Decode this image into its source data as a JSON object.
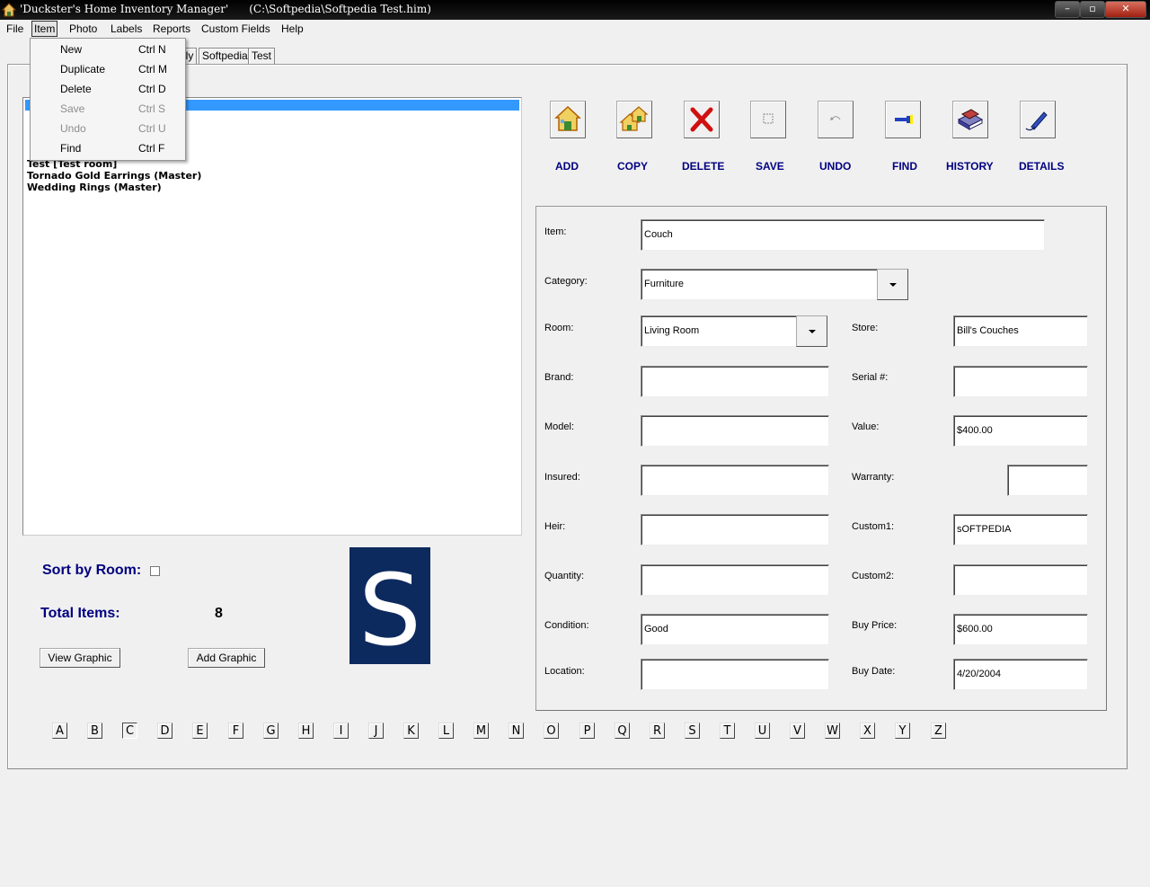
{
  "window": {
    "title": "'Duckster's Home Inventory Manager'      (C:\\Softpedia\\Softpedia Test.him)",
    "minimize": "–",
    "maximize": "▫",
    "close": "✕"
  },
  "menu": [
    "File",
    "Item",
    "Photo",
    "Labels",
    "Reports",
    "Custom Fields",
    "Help"
  ],
  "item_menu": [
    {
      "label": "New",
      "shortcut": "Ctrl N",
      "enabled": true
    },
    {
      "label": "Duplicate",
      "shortcut": "Ctrl M",
      "enabled": true
    },
    {
      "label": "Delete",
      "shortcut": "Ctrl D",
      "enabled": true
    },
    {
      "label": "Save",
      "shortcut": "Ctrl S",
      "enabled": false
    },
    {
      "label": "Undo",
      "shortcut": "Ctrl U",
      "enabled": false
    },
    {
      "label": "Find",
      "shortcut": "Ctrl F",
      "enabled": true
    }
  ],
  "tabs": [
    "lly",
    "Softpedia",
    "Test"
  ],
  "item_list": [
    "Test [Test room]",
    "Tornado Gold Earrings (Master)",
    "Wedding Rings (Master)"
  ],
  "toolbar": [
    {
      "label": "ADD",
      "icon": "house-add-icon"
    },
    {
      "label": "COPY",
      "icon": "house-copy-icon"
    },
    {
      "label": "DELETE",
      "icon": "red-x-icon"
    },
    {
      "label": "SAVE",
      "icon": "save-icon"
    },
    {
      "label": "UNDO",
      "icon": "undo-icon"
    },
    {
      "label": "FIND",
      "icon": "flashlight-icon"
    },
    {
      "label": "HISTORY",
      "icon": "books-icon"
    },
    {
      "label": "DETAILS",
      "icon": "pen-icon"
    }
  ],
  "form": {
    "item": {
      "label": "Item:",
      "value": "Couch"
    },
    "category": {
      "label": "Category:",
      "value": "Furniture"
    },
    "room": {
      "label": "Room:",
      "value": "Living Room"
    },
    "store": {
      "label": "Store:",
      "value": "Bill's Couches"
    },
    "brand": {
      "label": "Brand:",
      "value": ""
    },
    "serial": {
      "label": "Serial #:",
      "value": ""
    },
    "model": {
      "label": "Model:",
      "value": ""
    },
    "value": {
      "label": "Value:",
      "value": "$400.00"
    },
    "insured": {
      "label": "Insured:",
      "value": ""
    },
    "warranty": {
      "label": "Warranty:",
      "value": ""
    },
    "heir": {
      "label": "Heir:",
      "value": ""
    },
    "custom1": {
      "label": "Custom1:",
      "value": "sOFTPEDIA"
    },
    "quantity": {
      "label": "Quantity:",
      "value": ""
    },
    "custom2": {
      "label": "Custom2:",
      "value": ""
    },
    "condition": {
      "label": "Condition:",
      "value": "Good"
    },
    "buy_price": {
      "label": "Buy Price:",
      "value": "$600.00"
    },
    "location": {
      "label": "Location:",
      "value": ""
    },
    "buy_date": {
      "label": "Buy Date:",
      "value": "4/20/2004"
    }
  },
  "sort_by_room": {
    "label": "Sort by Room:",
    "checked": false
  },
  "total_items": {
    "label": "Total Items:",
    "value": "8"
  },
  "buttons": {
    "view_graphic": "View Graphic",
    "add_graphic": "Add Graphic"
  },
  "logo_letter": "S",
  "letters": [
    "A",
    "B",
    "C",
    "D",
    "E",
    "F",
    "G",
    "H",
    "I",
    "J",
    "K",
    "L",
    "M",
    "N",
    "O",
    "P",
    "Q",
    "R",
    "S",
    "T",
    "U",
    "V",
    "W",
    "X",
    "Y",
    "Z"
  ],
  "pressed_letter": "C",
  "colors": {
    "accent_blue": "#000080",
    "selection": "#3399ff",
    "logo_bg": "#0d2a5e"
  }
}
